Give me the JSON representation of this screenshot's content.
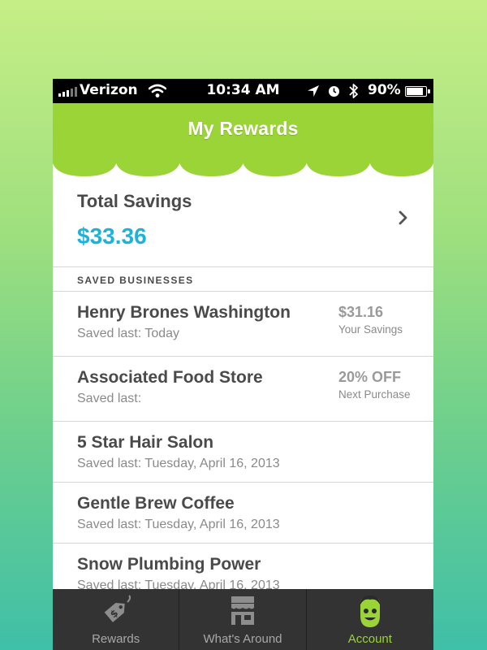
{
  "status_bar": {
    "carrier": "Verizon",
    "time": "10:34 AM",
    "battery": "90%",
    "battery_level": 0.9
  },
  "header": {
    "title": "My Rewards",
    "color": "#9bd437"
  },
  "savings": {
    "label": "Total Savings",
    "amount": "$33.36",
    "amount_color": "#1cb3d8"
  },
  "section": {
    "title": "SAVED BUSINESSES"
  },
  "businesses": [
    {
      "name": "Henry Brones Washington",
      "saved": "Saved last: Today",
      "value": "$31.16",
      "value_caption": "Your Savings"
    },
    {
      "name": "Associated Food Store",
      "saved": "Saved last:",
      "value": "20% OFF",
      "value_caption": "Next Purchase"
    },
    {
      "name": "5 Star Hair Salon",
      "saved": "Saved last: Tuesday, April 16, 2013"
    },
    {
      "name": "Gentle Brew Coffee",
      "saved": "Saved last: Tuesday, April 16, 2013"
    },
    {
      "name": "Snow Plumbing Power",
      "saved": "Saved last: Tuesday, April 16, 2013"
    }
  ],
  "tabs": [
    {
      "label": "Rewards",
      "icon": "price-tag-icon"
    },
    {
      "label": "What's Around",
      "icon": "storefront-icon"
    },
    {
      "label": "Account",
      "icon": "smiley-face-icon",
      "active": true
    }
  ]
}
